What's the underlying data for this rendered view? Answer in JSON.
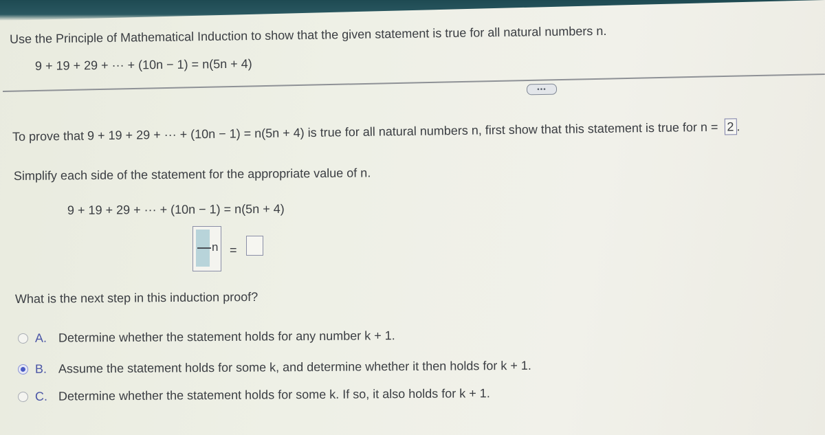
{
  "question": {
    "instruction": "Use the Principle of Mathematical Induction to show that the given statement is true for all natural numbers n.",
    "statement": "9 + 19 + 29 + ··· + (10n − 1) = n(5n + 4)"
  },
  "more_button": {
    "label": "•••"
  },
  "step1": {
    "prove_prefix": "To prove that 9 + 19 + 29 + ··· + (10n − 1) = n(5n + 4) is true for all natural numbers n, first show that this statement is true for n =",
    "n_value": "2",
    "prove_suffix": ".",
    "simplify_instruction": "Simplify each side of the statement for the appropriate value of n.",
    "work_equation": "9 + 19 + 29 + ··· + (10n − 1)  =  n(5n + 4)",
    "lhs_input_suffix": "n",
    "equals_sign": "=",
    "rhs_input_value": ""
  },
  "step2": {
    "question": "What is the next step in this induction proof?",
    "options": [
      {
        "letter": "A.",
        "text": "Determine whether the statement holds for any number k + 1.",
        "selected": false
      },
      {
        "letter": "B.",
        "text": "Assume the statement holds for some k, and determine whether it then holds for k + 1.",
        "selected": true
      },
      {
        "letter": "C.",
        "text": "Determine whether the statement holds for some k. If so, it also holds for k + 1.",
        "selected": false
      }
    ]
  }
}
